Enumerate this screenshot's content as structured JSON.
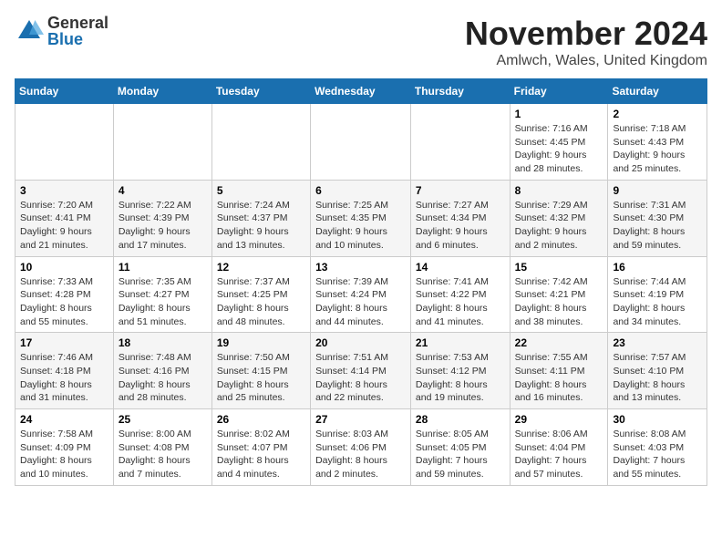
{
  "header": {
    "logo": {
      "general": "General",
      "blue": "Blue"
    },
    "title": "November 2024",
    "subtitle": "Amlwch, Wales, United Kingdom"
  },
  "weekdays": [
    "Sunday",
    "Monday",
    "Tuesday",
    "Wednesday",
    "Thursday",
    "Friday",
    "Saturday"
  ],
  "weeks": [
    [
      {
        "day": "",
        "info": ""
      },
      {
        "day": "",
        "info": ""
      },
      {
        "day": "",
        "info": ""
      },
      {
        "day": "",
        "info": ""
      },
      {
        "day": "",
        "info": ""
      },
      {
        "day": "1",
        "info": "Sunrise: 7:16 AM\nSunset: 4:45 PM\nDaylight: 9 hours and 28 minutes."
      },
      {
        "day": "2",
        "info": "Sunrise: 7:18 AM\nSunset: 4:43 PM\nDaylight: 9 hours and 25 minutes."
      }
    ],
    [
      {
        "day": "3",
        "info": "Sunrise: 7:20 AM\nSunset: 4:41 PM\nDaylight: 9 hours and 21 minutes."
      },
      {
        "day": "4",
        "info": "Sunrise: 7:22 AM\nSunset: 4:39 PM\nDaylight: 9 hours and 17 minutes."
      },
      {
        "day": "5",
        "info": "Sunrise: 7:24 AM\nSunset: 4:37 PM\nDaylight: 9 hours and 13 minutes."
      },
      {
        "day": "6",
        "info": "Sunrise: 7:25 AM\nSunset: 4:35 PM\nDaylight: 9 hours and 10 minutes."
      },
      {
        "day": "7",
        "info": "Sunrise: 7:27 AM\nSunset: 4:34 PM\nDaylight: 9 hours and 6 minutes."
      },
      {
        "day": "8",
        "info": "Sunrise: 7:29 AM\nSunset: 4:32 PM\nDaylight: 9 hours and 2 minutes."
      },
      {
        "day": "9",
        "info": "Sunrise: 7:31 AM\nSunset: 4:30 PM\nDaylight: 8 hours and 59 minutes."
      }
    ],
    [
      {
        "day": "10",
        "info": "Sunrise: 7:33 AM\nSunset: 4:28 PM\nDaylight: 8 hours and 55 minutes."
      },
      {
        "day": "11",
        "info": "Sunrise: 7:35 AM\nSunset: 4:27 PM\nDaylight: 8 hours and 51 minutes."
      },
      {
        "day": "12",
        "info": "Sunrise: 7:37 AM\nSunset: 4:25 PM\nDaylight: 8 hours and 48 minutes."
      },
      {
        "day": "13",
        "info": "Sunrise: 7:39 AM\nSunset: 4:24 PM\nDaylight: 8 hours and 44 minutes."
      },
      {
        "day": "14",
        "info": "Sunrise: 7:41 AM\nSunset: 4:22 PM\nDaylight: 8 hours and 41 minutes."
      },
      {
        "day": "15",
        "info": "Sunrise: 7:42 AM\nSunset: 4:21 PM\nDaylight: 8 hours and 38 minutes."
      },
      {
        "day": "16",
        "info": "Sunrise: 7:44 AM\nSunset: 4:19 PM\nDaylight: 8 hours and 34 minutes."
      }
    ],
    [
      {
        "day": "17",
        "info": "Sunrise: 7:46 AM\nSunset: 4:18 PM\nDaylight: 8 hours and 31 minutes."
      },
      {
        "day": "18",
        "info": "Sunrise: 7:48 AM\nSunset: 4:16 PM\nDaylight: 8 hours and 28 minutes."
      },
      {
        "day": "19",
        "info": "Sunrise: 7:50 AM\nSunset: 4:15 PM\nDaylight: 8 hours and 25 minutes."
      },
      {
        "day": "20",
        "info": "Sunrise: 7:51 AM\nSunset: 4:14 PM\nDaylight: 8 hours and 22 minutes."
      },
      {
        "day": "21",
        "info": "Sunrise: 7:53 AM\nSunset: 4:12 PM\nDaylight: 8 hours and 19 minutes."
      },
      {
        "day": "22",
        "info": "Sunrise: 7:55 AM\nSunset: 4:11 PM\nDaylight: 8 hours and 16 minutes."
      },
      {
        "day": "23",
        "info": "Sunrise: 7:57 AM\nSunset: 4:10 PM\nDaylight: 8 hours and 13 minutes."
      }
    ],
    [
      {
        "day": "24",
        "info": "Sunrise: 7:58 AM\nSunset: 4:09 PM\nDaylight: 8 hours and 10 minutes."
      },
      {
        "day": "25",
        "info": "Sunrise: 8:00 AM\nSunset: 4:08 PM\nDaylight: 8 hours and 7 minutes."
      },
      {
        "day": "26",
        "info": "Sunrise: 8:02 AM\nSunset: 4:07 PM\nDaylight: 8 hours and 4 minutes."
      },
      {
        "day": "27",
        "info": "Sunrise: 8:03 AM\nSunset: 4:06 PM\nDaylight: 8 hours and 2 minutes."
      },
      {
        "day": "28",
        "info": "Sunrise: 8:05 AM\nSunset: 4:05 PM\nDaylight: 7 hours and 59 minutes."
      },
      {
        "day": "29",
        "info": "Sunrise: 8:06 AM\nSunset: 4:04 PM\nDaylight: 7 hours and 57 minutes."
      },
      {
        "day": "30",
        "info": "Sunrise: 8:08 AM\nSunset: 4:03 PM\nDaylight: 7 hours and 55 minutes."
      }
    ]
  ]
}
